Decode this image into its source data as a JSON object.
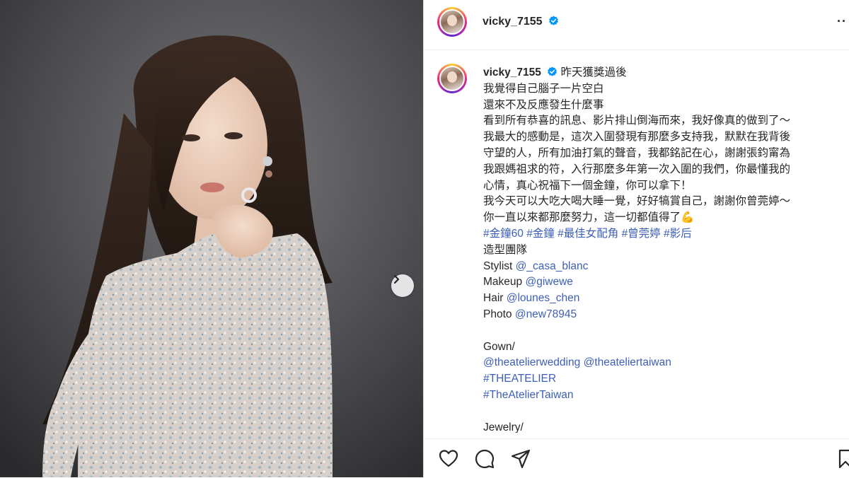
{
  "post": {
    "username": "vicky_7155",
    "verified_icon": "verified-badge-icon",
    "more_label": "··",
    "caption_first_text": "昨天獲獎過後",
    "caption_lines": [
      "我覺得自己腦子一片空白",
      "還來不及反應發生什麼事",
      "看到所有恭喜的訊息、影片排山倒海而來，我好像真的做到了～",
      "我最大的感動是，這次入圍發現有那麼多支持我，默默在我背後",
      "守望的人，所有加油打氣的聲音，我都銘記在心，謝謝張鈞甯為",
      "我跟媽祖求的符，入行那麼多年第一次入圍的我們，你最懂我的",
      "心情，真心祝福下一個金鐘，你可以拿下！",
      "我今天可以大吃大喝大睡一覺，好好犒賞自己，謝謝你曾莞婷～"
    ],
    "last_line_text": "你一直以來都那麼努力，這一切都值得了",
    "last_line_emoji": "💪",
    "hashtags": [
      "#金鐘60",
      "#金鐘",
      "#最佳女配角",
      "#曾莞婷",
      "#影后"
    ],
    "team_heading": "造型團隊",
    "credits": [
      {
        "role": "Stylist",
        "handle": "@_casa_blanc"
      },
      {
        "role": "Makeup",
        "handle": "@giwewe"
      },
      {
        "role": "Hair",
        "handle": "@lounes_chen"
      },
      {
        "role": "Photo",
        "handle": "@new78945"
      }
    ],
    "gown_heading": "Gown/",
    "gown_handles": [
      "@theatelierwedding",
      "@theateliertaiwan"
    ],
    "gown_tags": [
      "#THEATELIER",
      "#TheAtelierTaiwan"
    ],
    "jewelry_heading": "Jewelry/"
  },
  "actions": {
    "like_icon": "heart-icon",
    "comment_icon": "comment-icon",
    "share_icon": "send-icon",
    "save_icon": "bookmark-icon"
  },
  "colors": {
    "link": "#3d5fb8",
    "verified": "#0095f6",
    "text": "#262626"
  }
}
